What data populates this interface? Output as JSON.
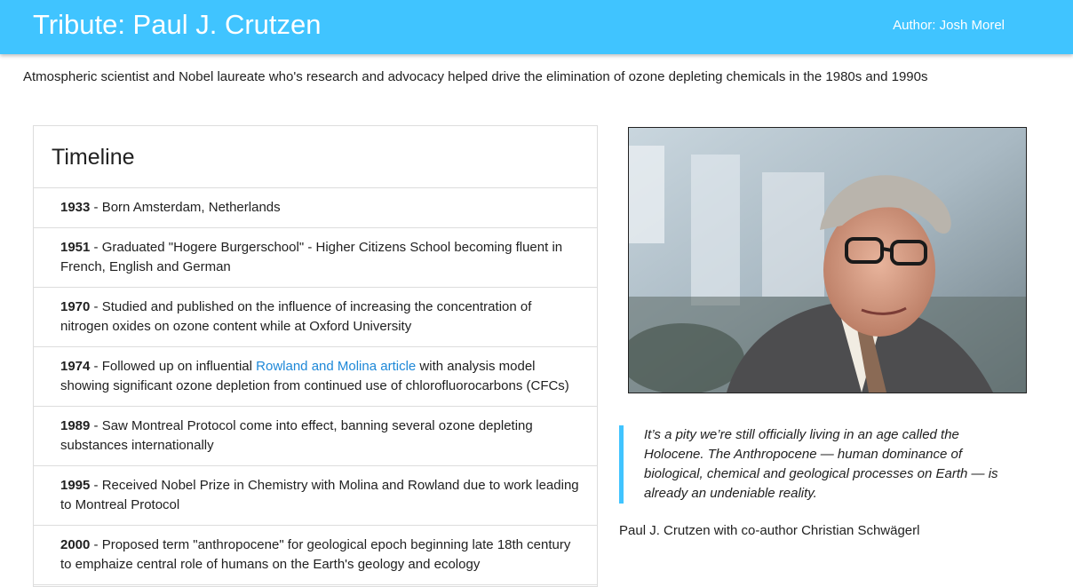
{
  "header": {
    "title": "Tribute: Paul J. Crutzen",
    "author": "Author: Josh Morel",
    "accent_color": "#40c4ff"
  },
  "subtitle": "Atmospheric scientist and Nobel laureate who's research and advocacy helped drive the elimination of ozone depleting chemicals in the 1980s and 1990s",
  "timeline": {
    "title": "Timeline",
    "items": [
      {
        "year": "1933",
        "text": " - Born Amsterdam, Netherlands"
      },
      {
        "year": "1951",
        "text": " - Graduated \"Hogere Burgerschool\" - Higher Citizens School becoming fluent in French, English and German"
      },
      {
        "year": "1970",
        "text": " - Studied and published on the influence of increasing the concentration of nitrogen oxides on ozone content while at Oxford University"
      },
      {
        "year": "1974",
        "text_before": " - Followed up on influential ",
        "link": "Rowland and Molina article",
        "text_after": " with analysis model showing significant ozone depletion from continued use of chlorofluorocarbons (CFCs)"
      },
      {
        "year": "1989",
        "text": " - Saw Montreal Protocol come into effect, banning several ozone depleting substances internationally"
      },
      {
        "year": "1995",
        "text": " - Received Nobel Prize in Chemistry with Molina and Rowland due to work leading to Montreal Protocol"
      },
      {
        "year": "2000",
        "text": " - Proposed term \"anthropocene\" for geological epoch beginning late 18th century to emphaize central role of humans on the Earth's geology and ecology"
      }
    ]
  },
  "quote": {
    "text": "It’s a pity we’re still officially living in an age called the Holocene. The Anthropocene — human dominance of biological, chemical and geological processes on Earth — is already an undeniable reality."
  },
  "caption": "Paul J. Crutzen with co-author Christian Schwägerl",
  "photo": {
    "icon": "portrait-photo"
  }
}
